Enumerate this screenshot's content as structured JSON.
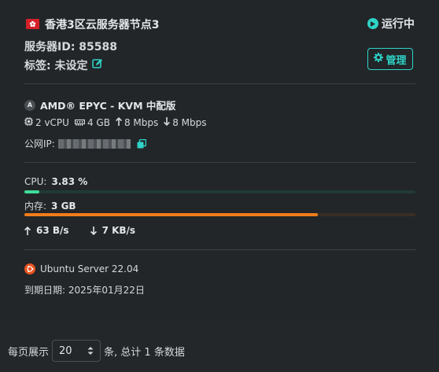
{
  "server": {
    "title": "香港3区云服务器节点3",
    "status": "运行中",
    "id_label": "服务器ID: 85588",
    "tags_label": "标签: 未设定",
    "manage_label": "管理"
  },
  "hardware": {
    "cpu_model": "AMD® EPYC - KVM 中配版",
    "vcpu": "2 vCPU",
    "memory": "4 GB",
    "upload": "8 Mbps",
    "download": "8 Mbps",
    "ip_label": "公网IP:"
  },
  "usage": {
    "cpu_label": "CPU:",
    "cpu_value": "3.83 %",
    "cpu_fraction": 0.0383,
    "mem_label": "内存:",
    "mem_value": "3 GB",
    "mem_fraction": 0.75,
    "net_up": "63 B/s",
    "net_down": "7 KB/s"
  },
  "os": {
    "name": "Ubuntu Server 22.04",
    "expire": "到期日期: 2025年01月22日"
  },
  "pagination": {
    "prefix": "每页展示",
    "page_size": "20",
    "suffix": "条, 总计 1 条数据"
  },
  "colors": {
    "accent": "#2fd3c7",
    "cpu_bar": "#3ddc97",
    "cpu_track": "#1f3a33",
    "mem_bar": "#f07d1a",
    "mem_track": "#3a2e24",
    "ubuntu": "#e95420"
  }
}
